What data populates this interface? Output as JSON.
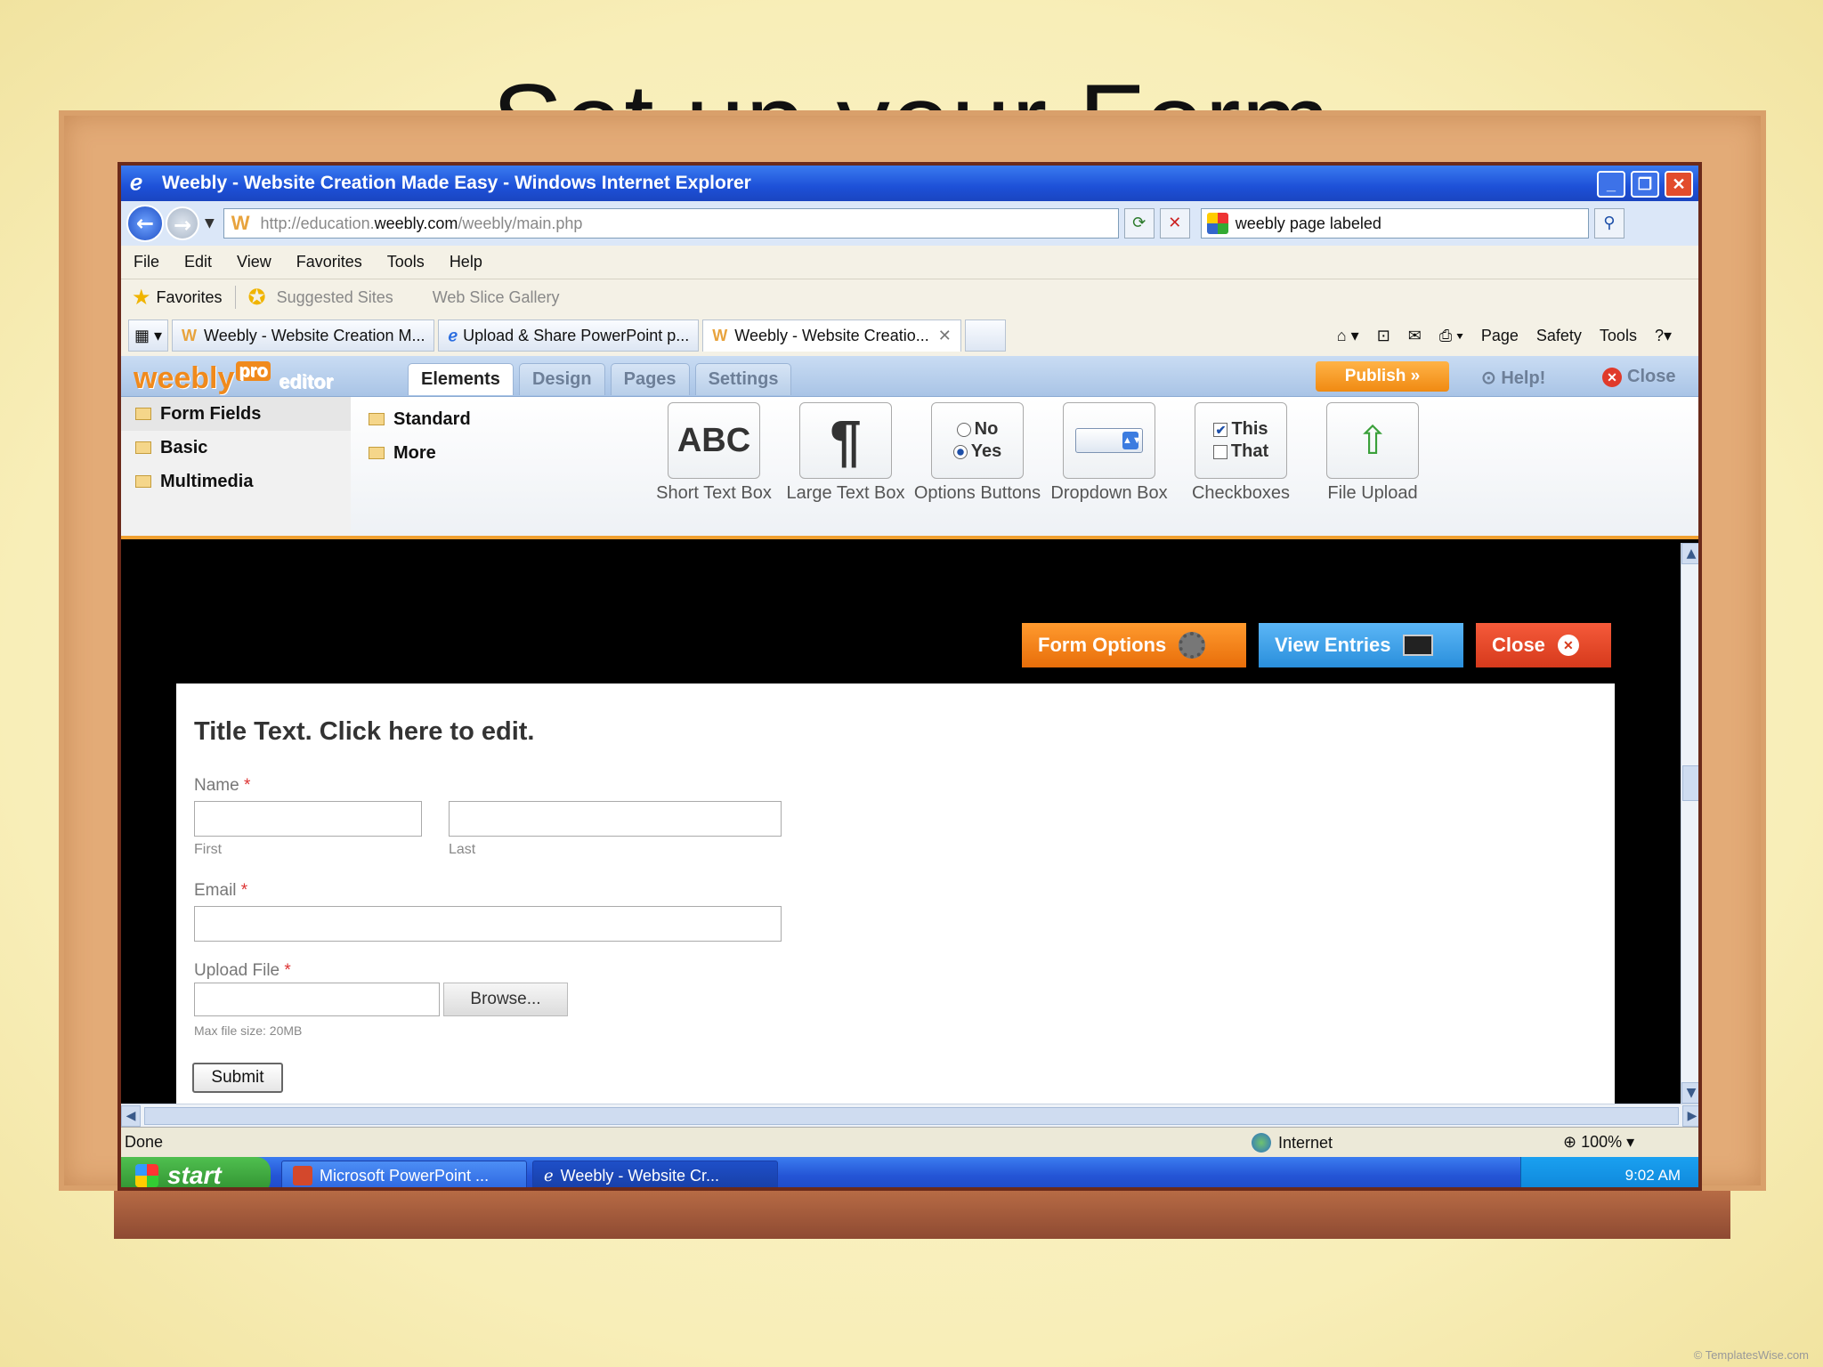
{
  "slide": {
    "title": "Set up your Form",
    "copyright": "© TemplatesWise.com"
  },
  "window": {
    "title": "Weebly - Website Creation Made Easy - Windows Internet Explorer",
    "controls": {
      "minimize": "_",
      "restore": "❐",
      "close": "✕"
    }
  },
  "address": {
    "url_prefix": "http://education.",
    "url_domain": "weebly.com",
    "url_path": "/weebly/main.php",
    "search_text": "weebly page labeled"
  },
  "menu": [
    "File",
    "Edit",
    "View",
    "Favorites",
    "Tools",
    "Help"
  ],
  "favorites": {
    "label": "Favorites",
    "suggested": "Suggested Sites",
    "slice": "Web Slice Gallery"
  },
  "tabs": [
    {
      "label": "Weebly - Website Creation M..."
    },
    {
      "label": "Upload & Share PowerPoint p..."
    },
    {
      "label": "Weebly - Website Creatio..."
    }
  ],
  "tab_tools": {
    "page": "Page",
    "safety": "Safety",
    "tools": "Tools"
  },
  "editor": {
    "logo": "weebly",
    "logo_badge": "pro",
    "logo_suffix": "editor",
    "tabs": [
      "Elements",
      "Design",
      "Pages",
      "Settings"
    ],
    "publish": "Publish »",
    "help": "Help!",
    "close": "Close"
  },
  "categories": [
    "Form Fields",
    "Basic",
    "Multimedia"
  ],
  "subcategories": [
    "Standard",
    "More"
  ],
  "elements": [
    {
      "label": "Short Text Box",
      "icon": "ABC"
    },
    {
      "label": "Large Text Box",
      "icon": "¶"
    },
    {
      "label": "Options Buttons",
      "opt1": "No",
      "opt2": "Yes"
    },
    {
      "label": "Dropdown Box"
    },
    {
      "label": "Checkboxes",
      "opt1": "This",
      "opt2": "That"
    },
    {
      "label": "File Upload"
    }
  ],
  "form_actions": {
    "options": "Form Options",
    "entries": "View Entries",
    "close": "Close"
  },
  "form": {
    "title": "Title Text. Click here to edit.",
    "name_label": "Name",
    "first": "First",
    "last": "Last",
    "email_label": "Email",
    "upload_label": "Upload File",
    "browse": "Browse...",
    "max_size": "Max file size: 20MB",
    "submit": "Submit",
    "required": "*"
  },
  "status": {
    "text": "Done",
    "zone": "Internet",
    "zoom": "100%"
  },
  "taskbar": {
    "start": "start",
    "items": [
      "Microsoft PowerPoint ...",
      "Weebly - Website Cr..."
    ],
    "time": "9:02 AM"
  }
}
